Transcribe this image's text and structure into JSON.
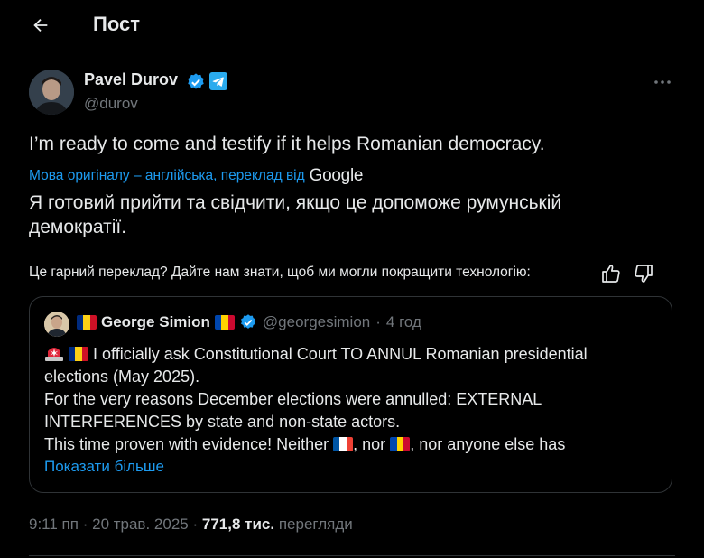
{
  "header": {
    "title": "Пост"
  },
  "tweet": {
    "author_name": "Pavel Durov",
    "author_handle": "@durov",
    "text": "I’m ready to come and testify if it helps Romanian democracy.",
    "translation_note": "Мова оригіналу – англійська, переклад від",
    "translation_provider": "Google",
    "translated_text": "Я готовий прийти та свідчити, якщо це допоможе румунській демократії.",
    "feedback_prompt": "Це гарний переклад? Дайте нам знати, щоб ми могли покращити технологію:"
  },
  "quote": {
    "author_name": "George Simion",
    "author_handle": "@georgesimion",
    "separator": "·",
    "time": "4 год",
    "line1": "I officially ask Constitutional Court TO ANNUL Romanian presidential",
    "line2": "elections (May 2025).",
    "line3": "For the very reasons December elections were annulled: EXTERNAL",
    "line4": "INTERFERENCES by state and non-state actors.",
    "line5_a": "This time proven with evidence! Neither",
    "line5_b": ", nor",
    "line5_c": ", nor anyone else has",
    "show_more": "Показати більше"
  },
  "meta": {
    "time": "9:11 пп",
    "separator": "·",
    "date": "20 трав. 2025",
    "views_count": "771,8 тис.",
    "views_label": "перегляди"
  },
  "colors": {
    "accent": "#1d9bf0",
    "muted": "#71767b",
    "text": "#e7e9ea",
    "border": "#2f3336",
    "telegram": "#2aabee"
  },
  "icons": [
    "back-arrow-icon",
    "verified-badge-icon",
    "telegram-icon",
    "more-icon",
    "thumb-up-icon",
    "thumb-down-icon",
    "romania-flag-icon",
    "moldova-flag-icon",
    "france-flag-icon",
    "siren-icon"
  ]
}
